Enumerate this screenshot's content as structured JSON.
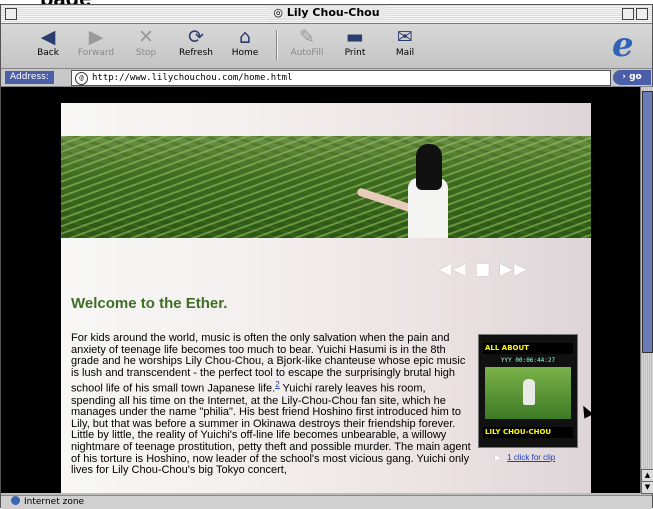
{
  "top_crop_text": "page",
  "window": {
    "title": "Lily Chou-Chou"
  },
  "toolbar": {
    "back": "Back",
    "forward": "Forward",
    "stop": "Stop",
    "refresh": "Refresh",
    "home": "Home",
    "autofill": "AutoFill",
    "print": "Print",
    "mail": "Mail"
  },
  "address": {
    "label": "Address:",
    "url": "http://www.lilychouchou.com/home.html",
    "go": "go"
  },
  "page": {
    "pager": "◀◀ ■ ▶▶",
    "heading": "Welcome to the Ether.",
    "body_pre": "For kids around the world, music is often the only salvation when the pain and anxiety of teenage life becomes too much to bear. Yuichi Hasumi is in the 8th grade and he worships Lily Chou-Chou, a Bjork-like chanteuse whose epic music is lush and transcendent - the perfect tool to escape the surprisingly brutal high school life of his small town Japanese life.",
    "footnote": "2",
    "body_post": " Yuichi rarely leaves his room, spending all his time on the Internet, at the Lily-Chou-Chou fan site, which he manages under the name \"philia\". His best friend Hoshino first introduced him to Lily, but that was before a summer in Okinawa destroys their friendship forever. Little by little, the reality of Yuichi's off-line life becomes unbearable, a willowy nightmare of teenage prostitution, petty theft and possible murder. The main agent of his torture is Hoshino, now leader of the school's most vicious gang. Yuichi only lives for Lily Chou-Chou's big Tokyo concert,",
    "thumb_top": "ALL ABOUT",
    "thumb_timestamp": "YYY 00:06:44:27",
    "thumb_bottom": "LILY CHOU-CHOU",
    "clip_link": "1 click for clip"
  },
  "status": {
    "zone": "Internet zone"
  }
}
